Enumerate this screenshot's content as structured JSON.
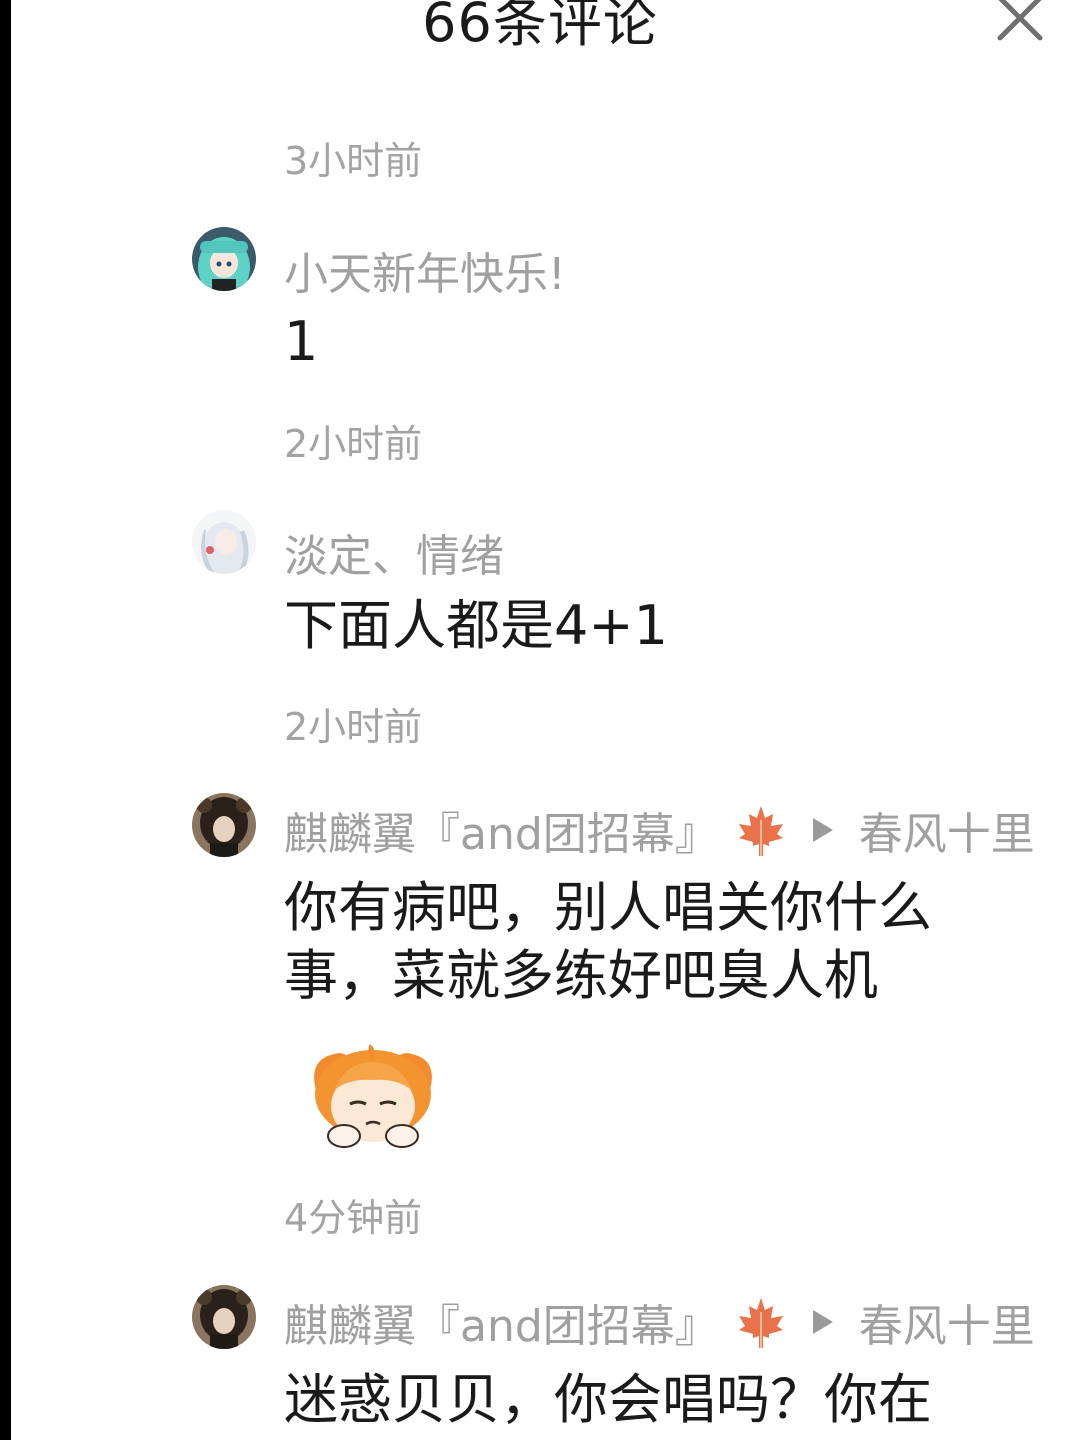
{
  "header": {
    "title": "66条评论"
  },
  "comments": [
    {
      "time_above": "3小时前",
      "username": "小天新年快乐!",
      "text_lines": [
        "1"
      ]
    },
    {
      "time_above": "2小时前",
      "username": "淡定、情绪",
      "text_lines": [
        "下面人都是4+1"
      ]
    },
    {
      "time_above": "2小时前",
      "username": "麒麟翼『and团招幕』",
      "reply_to": "春风十里",
      "text_lines": [
        "你有病吧，别人唱关你什么",
        "事，菜就多练好吧臭人机"
      ],
      "has_sticker": true
    },
    {
      "time_above": "4分钟前",
      "username": "麒麟翼『and团招幕』",
      "reply_to": "春风十里",
      "text_lines": [
        "迷惑贝贝，你会唱吗？你在"
      ]
    }
  ],
  "icons": {
    "close": "close-icon",
    "maple": "maple-leaf-icon",
    "reply_arrow": "play-triangle-icon"
  },
  "colors": {
    "timestamp": "#a3a3a3",
    "username": "#a0a0a0",
    "text": "#1a1a1a",
    "maple": "#e8734a"
  }
}
